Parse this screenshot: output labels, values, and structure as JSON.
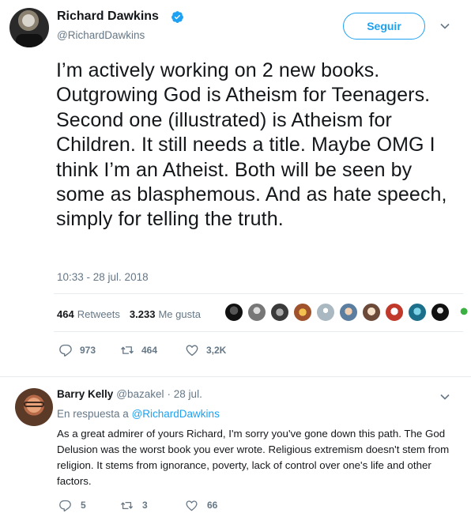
{
  "tweet": {
    "author_name": "Richard Dawkins",
    "author_handle": "@RichardDawkins",
    "verified": true,
    "follow_label": "Seguir",
    "text": "I’m actively working on 2 new books. Outgrowing God is Atheism for Teenagers. Second one (illustrated) is Atheism for Children. It still needs a title. Maybe OMG I think I’m an Atheist. Both will be seen by some as blasphemous. And as hate speech, simply for telling the truth.",
    "timestamp": "10:33 - 28 jul. 2018",
    "retweets_count": "464",
    "retweets_label": "Retweets",
    "likes_count": "3.233",
    "likes_label": "Me gusta",
    "reply_count": "973",
    "retweet_count": "464",
    "like_count": "3,2K"
  },
  "reply": {
    "author_name": "Barry Kelly",
    "author_handle": "@bazakel",
    "date": "· 28 jul.",
    "in_reply_prefix": "En respuesta a",
    "in_reply_mention": "@RichardDawkins",
    "text": "As a great admirer of yours Richard, I'm sorry you've gone down this path. The God Delusion was the worst book you ever wrote. Religious extremism doesn't stem from religion. It stems from ignorance, poverty, lack of control over one's life and other factors.",
    "reply_count": "5",
    "retweet_count": "3",
    "like_count": "66"
  },
  "colors": {
    "accent": "#1da1f2",
    "secondary_text": "#657786",
    "primary_text": "#14171a",
    "divider": "#e6ecf0"
  },
  "icons": [
    "verified-badge-icon",
    "chevron-down-icon",
    "reply-icon",
    "retweet-icon",
    "like-icon"
  ]
}
